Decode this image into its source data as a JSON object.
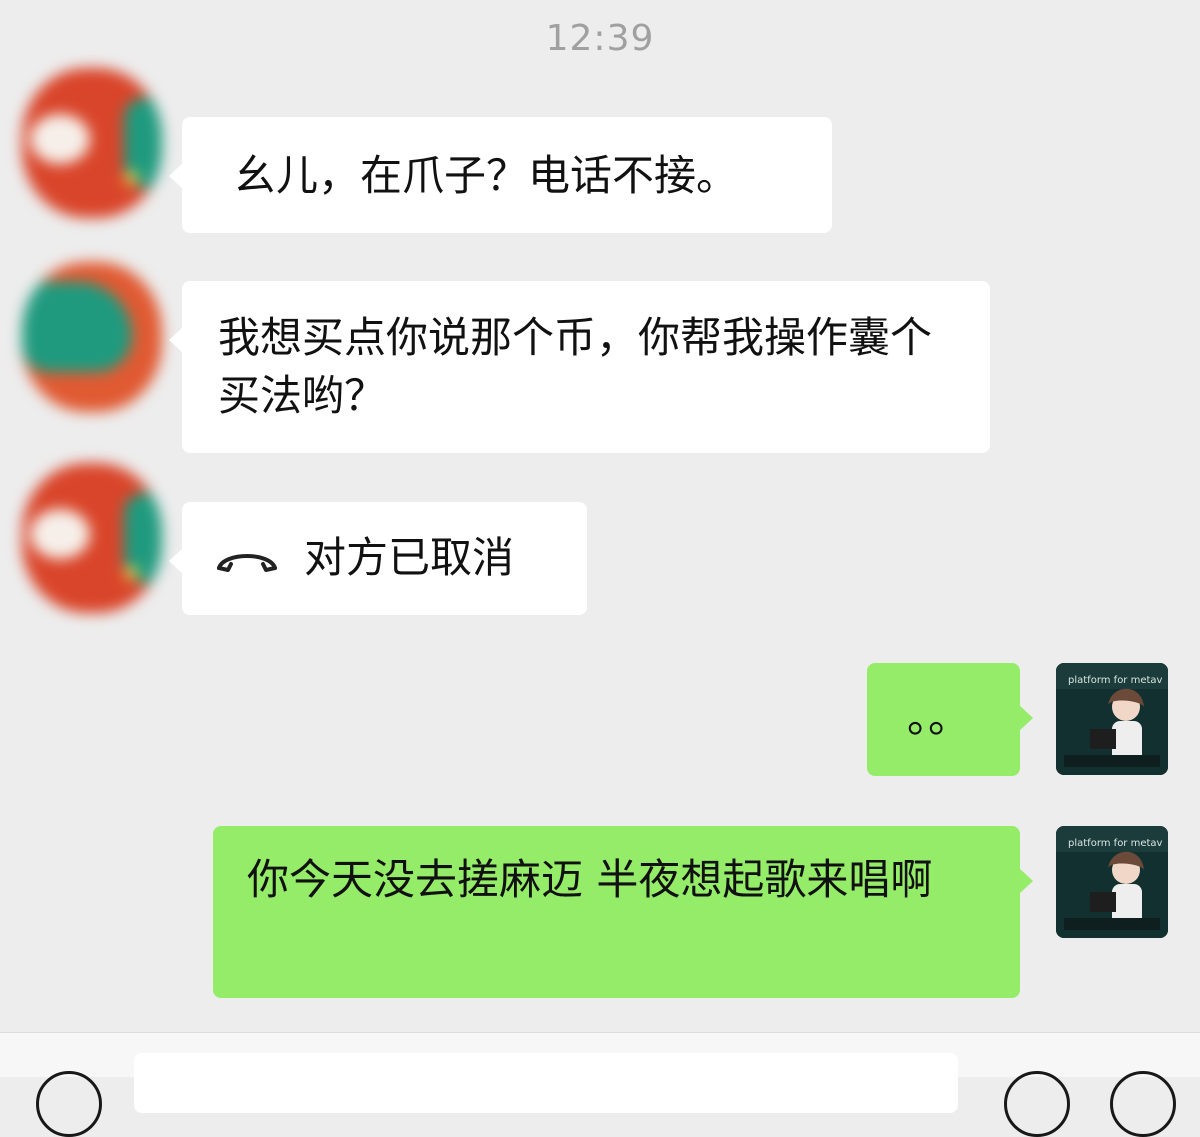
{
  "chat": {
    "timestamp": "12:39",
    "messages": [
      {
        "side": "left",
        "text": "幺儿，在爪子？电话不接。"
      },
      {
        "side": "left",
        "text": "我想买点你说那个币，你帮我操作囊个买法哟？"
      },
      {
        "side": "left",
        "type": "call",
        "text": "对方已取消",
        "icon": "phone-hangup-icon"
      },
      {
        "side": "right",
        "text": "。。"
      },
      {
        "side": "right",
        "text": "你今天没去搓麻迈 半夜想起歌来唱啊"
      }
    ],
    "contact_avatar": {
      "icon": "christmas-avatar-icon"
    },
    "self_avatar": {
      "image_text": [
        "platform for metav"
      ]
    }
  },
  "input_bar": {
    "voice_icon": "voice-icon",
    "emoji_icon": "emoji-icon",
    "plus_icon": "plus-icon"
  },
  "colors": {
    "background": "#ededed",
    "incoming_bubble": "#ffffff",
    "outgoing_bubble": "#95ec69"
  }
}
